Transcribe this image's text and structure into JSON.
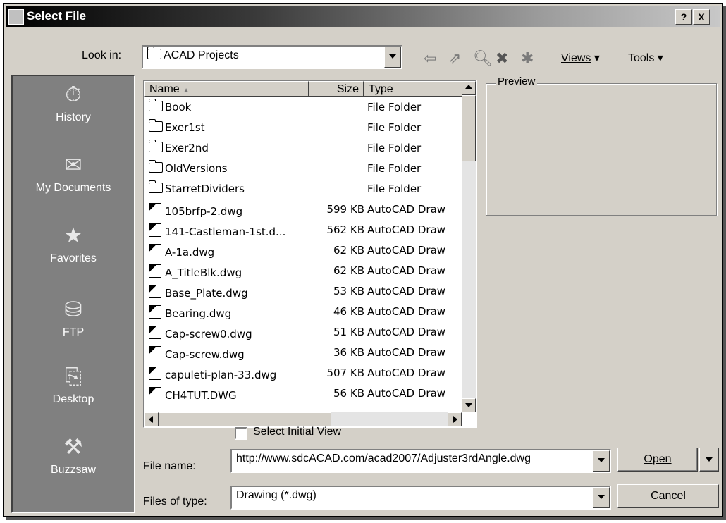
{
  "dialog": {
    "title": "Select File",
    "help_label": "?",
    "close_label": "X"
  },
  "look_in": {
    "label": "Look in:",
    "value": "ACAD Projects"
  },
  "toolbar": {
    "views_label": "Views",
    "tools_label": "Tools"
  },
  "places": [
    {
      "label": "History",
      "icon": "history-icon"
    },
    {
      "label": "My Documents",
      "icon": "my-documents-icon"
    },
    {
      "label": "Favorites",
      "icon": "favorites-icon"
    },
    {
      "label": "FTP",
      "icon": "ftp-icon"
    },
    {
      "label": "Desktop",
      "icon": "desktop-icon"
    },
    {
      "label": "Buzzsaw",
      "icon": "buzzsaw-icon"
    }
  ],
  "file_list": {
    "columns": {
      "name": "Name",
      "size": "Size",
      "type": "Type"
    },
    "rows": [
      {
        "name": "Book",
        "size": "",
        "type": "File Folder",
        "kind": "folder"
      },
      {
        "name": "Exer1st",
        "size": "",
        "type": "File Folder",
        "kind": "folder"
      },
      {
        "name": "Exer2nd",
        "size": "",
        "type": "File Folder",
        "kind": "folder"
      },
      {
        "name": "OldVersions",
        "size": "",
        "type": "File Folder",
        "kind": "folder"
      },
      {
        "name": "StarretDividers",
        "size": "",
        "type": "File Folder",
        "kind": "folder"
      },
      {
        "name": "105brfp-2.dwg",
        "size": "599 KB",
        "type": "AutoCAD Draw",
        "kind": "dwg"
      },
      {
        "name": "141-Castleman-1st.d...",
        "size": "562 KB",
        "type": "AutoCAD Draw",
        "kind": "dwg"
      },
      {
        "name": "A-1a.dwg",
        "size": "62 KB",
        "type": "AutoCAD Draw",
        "kind": "dwg"
      },
      {
        "name": "A_TitleBlk.dwg",
        "size": "62 KB",
        "type": "AutoCAD Draw",
        "kind": "dwg"
      },
      {
        "name": "Base_Plate.dwg",
        "size": "53 KB",
        "type": "AutoCAD Draw",
        "kind": "dwg"
      },
      {
        "name": "Bearing.dwg",
        "size": "46 KB",
        "type": "AutoCAD Draw",
        "kind": "dwg"
      },
      {
        "name": "Cap-screw0.dwg",
        "size": "51 KB",
        "type": "AutoCAD Draw",
        "kind": "dwg"
      },
      {
        "name": "Cap-screw.dwg",
        "size": "36 KB",
        "type": "AutoCAD Draw",
        "kind": "dwg"
      },
      {
        "name": "capuleti-plan-33.dwg",
        "size": "507 KB",
        "type": "AutoCAD Draw",
        "kind": "dwg"
      },
      {
        "name": "CH4TUT.DWG",
        "size": "56 KB",
        "type": "AutoCAD Draw",
        "kind": "dwg"
      }
    ]
  },
  "preview": {
    "label": "Preview"
  },
  "select_initial_view": {
    "label": "Select Initial View",
    "checked": false
  },
  "file_name": {
    "label": "File name:",
    "value": "http://www.sdcACAD.com/acad2007/Adjuster3rdAngle.dwg"
  },
  "files_of_type": {
    "label": "Files of type:",
    "value": "Drawing (*.dwg)"
  },
  "buttons": {
    "open": "Open",
    "cancel": "Cancel"
  }
}
